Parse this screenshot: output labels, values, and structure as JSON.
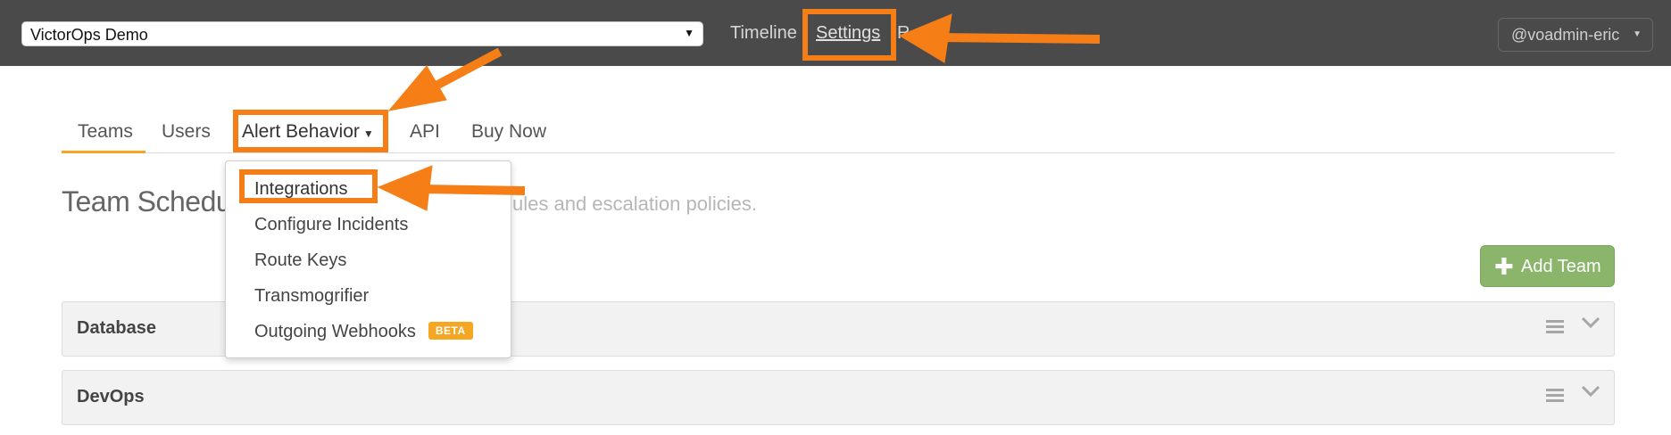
{
  "topbar": {
    "org_select": "VictorOps Demo",
    "nav": {
      "timeline": "Timeline",
      "settings": "Settings",
      "reports": "R"
    },
    "user_menu": "@voadmin-eric"
  },
  "tabs": {
    "teams": "Teams",
    "users": "Users",
    "alert_behavior": "Alert Behavior",
    "api": "API",
    "buy_now": "Buy Now",
    "active": "Teams"
  },
  "page": {
    "heading": "Team Schedul",
    "subheading": "ules and escalation policies."
  },
  "add_team_label": "Add Team",
  "dropdown": {
    "items": [
      {
        "label": "Integrations"
      },
      {
        "label": "Configure Incidents"
      },
      {
        "label": "Route Keys"
      },
      {
        "label": "Transmogrifier"
      },
      {
        "label": "Outgoing Webhooks",
        "badge": "BETA"
      }
    ]
  },
  "teams": [
    {
      "name": "Database"
    },
    {
      "name": "DevOps"
    }
  ],
  "colors": {
    "topbar": "#4a4a4a",
    "accent_annotation": "#f57e17",
    "add_team": "#8ab56b",
    "tab_active_underline": "#f5a623"
  }
}
